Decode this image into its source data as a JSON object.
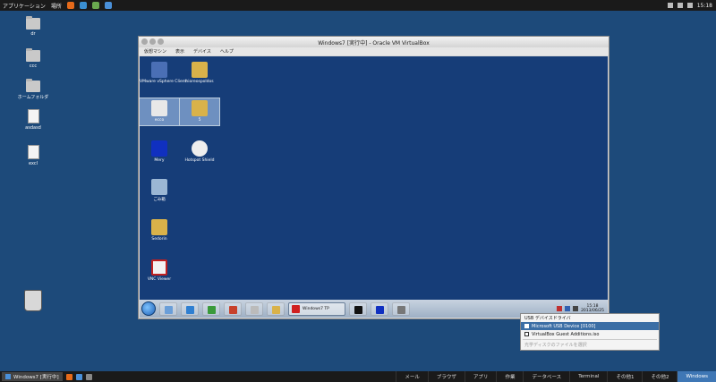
{
  "top_panel": {
    "app_menu": "アプリケーション",
    "places_menu": "場所",
    "clock": "15:18",
    "launcher_colors": [
      "#e66a1a",
      "#3b8fd1",
      "#6aa84f",
      "#4a90d9"
    ]
  },
  "desktop": {
    "icons": [
      {
        "label": "dr",
        "type": "folder"
      },
      {
        "label": "ccc",
        "type": "folder"
      },
      {
        "label": "ホームフォルダ",
        "type": "folder"
      },
      {
        "label": "asdasd",
        "type": "document"
      },
      {
        "label": "excl",
        "type": "document"
      },
      {
        "label": "",
        "type": "trash"
      }
    ]
  },
  "vm_window": {
    "title": "Windows7 [実行中] - Oracle VM VirtualBox",
    "menu": [
      "仮想マシン",
      "表示",
      "デバイス",
      "ヘルプ"
    ],
    "guest_icons": [
      {
        "label": "VMware vSphere Client",
        "color": "#4a6fb5"
      },
      {
        "label": "hioreospoldos",
        "color": "#d9b24a"
      },
      {
        "label": "ecco",
        "color": "#e8e8e8"
      },
      {
        "label": "5",
        "color": "#d9b24a"
      },
      {
        "label": "Mery",
        "color": "#1030c0"
      },
      {
        "label": "Hotspot Shield",
        "color": "#eeeeee"
      },
      {
        "label": "ごみ箱",
        "color": "#9bb7d4"
      },
      {
        "label": "Sedorin",
        "color": "#d9b24a"
      },
      {
        "label": "VNC Viewer",
        "color": "#f2f2f2"
      }
    ],
    "taskbar": {
      "active_task": "Windows7 TP",
      "clock_time": "15:18",
      "clock_date": "2013/06/25"
    }
  },
  "context_menu": {
    "items": [
      {
        "label": "USB デバイスドライバ",
        "state": "normal"
      },
      {
        "label": "Microsoft USB Device [0100]",
        "state": "highlighted"
      },
      {
        "label": "VirtualBox Guest Additions.iso",
        "state": "normal"
      },
      {
        "label": "光学ディスクのファイルを選択",
        "state": "disabled"
      }
    ]
  },
  "bottom_panel": {
    "task_entry": "Windows7 [実行中]",
    "workspaces": [
      "メール",
      "ブラウザ",
      "アプリ",
      "作業",
      "データベース",
      "Terminal",
      "その他1",
      "その他2",
      "Windows"
    ],
    "active_workspace": "Windows"
  }
}
